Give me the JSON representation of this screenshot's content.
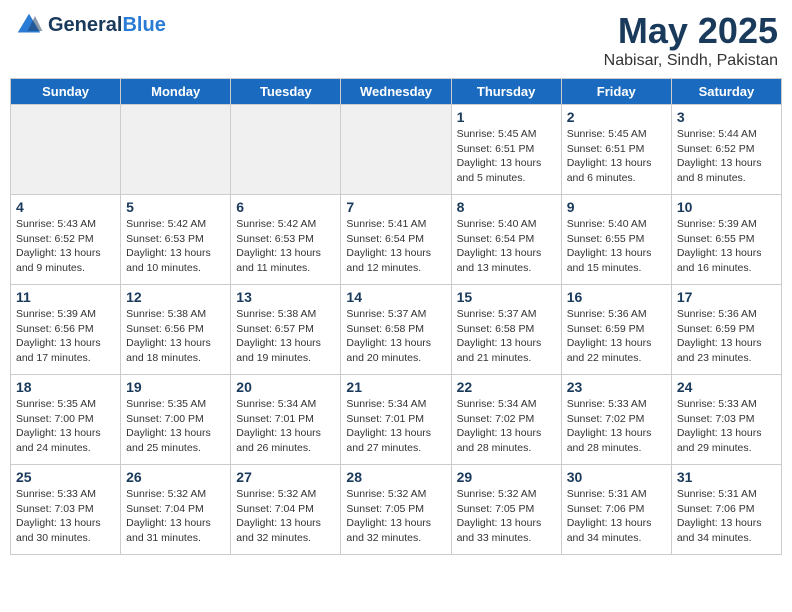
{
  "header": {
    "logo_line1": "General",
    "logo_line2": "Blue",
    "month_title": "May 2025",
    "location": "Nabisar, Sindh, Pakistan"
  },
  "weekdays": [
    "Sunday",
    "Monday",
    "Tuesday",
    "Wednesday",
    "Thursday",
    "Friday",
    "Saturday"
  ],
  "weeks": [
    [
      {
        "day": "",
        "info": "",
        "empty": true
      },
      {
        "day": "",
        "info": "",
        "empty": true
      },
      {
        "day": "",
        "info": "",
        "empty": true
      },
      {
        "day": "",
        "info": "",
        "empty": true
      },
      {
        "day": "1",
        "info": "Sunrise: 5:45 AM\nSunset: 6:51 PM\nDaylight: 13 hours\nand 5 minutes."
      },
      {
        "day": "2",
        "info": "Sunrise: 5:45 AM\nSunset: 6:51 PM\nDaylight: 13 hours\nand 6 minutes."
      },
      {
        "day": "3",
        "info": "Sunrise: 5:44 AM\nSunset: 6:52 PM\nDaylight: 13 hours\nand 8 minutes."
      }
    ],
    [
      {
        "day": "4",
        "info": "Sunrise: 5:43 AM\nSunset: 6:52 PM\nDaylight: 13 hours\nand 9 minutes."
      },
      {
        "day": "5",
        "info": "Sunrise: 5:42 AM\nSunset: 6:53 PM\nDaylight: 13 hours\nand 10 minutes."
      },
      {
        "day": "6",
        "info": "Sunrise: 5:42 AM\nSunset: 6:53 PM\nDaylight: 13 hours\nand 11 minutes."
      },
      {
        "day": "7",
        "info": "Sunrise: 5:41 AM\nSunset: 6:54 PM\nDaylight: 13 hours\nand 12 minutes."
      },
      {
        "day": "8",
        "info": "Sunrise: 5:40 AM\nSunset: 6:54 PM\nDaylight: 13 hours\nand 13 minutes."
      },
      {
        "day": "9",
        "info": "Sunrise: 5:40 AM\nSunset: 6:55 PM\nDaylight: 13 hours\nand 15 minutes."
      },
      {
        "day": "10",
        "info": "Sunrise: 5:39 AM\nSunset: 6:55 PM\nDaylight: 13 hours\nand 16 minutes."
      }
    ],
    [
      {
        "day": "11",
        "info": "Sunrise: 5:39 AM\nSunset: 6:56 PM\nDaylight: 13 hours\nand 17 minutes."
      },
      {
        "day": "12",
        "info": "Sunrise: 5:38 AM\nSunset: 6:56 PM\nDaylight: 13 hours\nand 18 minutes."
      },
      {
        "day": "13",
        "info": "Sunrise: 5:38 AM\nSunset: 6:57 PM\nDaylight: 13 hours\nand 19 minutes."
      },
      {
        "day": "14",
        "info": "Sunrise: 5:37 AM\nSunset: 6:58 PM\nDaylight: 13 hours\nand 20 minutes."
      },
      {
        "day": "15",
        "info": "Sunrise: 5:37 AM\nSunset: 6:58 PM\nDaylight: 13 hours\nand 21 minutes."
      },
      {
        "day": "16",
        "info": "Sunrise: 5:36 AM\nSunset: 6:59 PM\nDaylight: 13 hours\nand 22 minutes."
      },
      {
        "day": "17",
        "info": "Sunrise: 5:36 AM\nSunset: 6:59 PM\nDaylight: 13 hours\nand 23 minutes."
      }
    ],
    [
      {
        "day": "18",
        "info": "Sunrise: 5:35 AM\nSunset: 7:00 PM\nDaylight: 13 hours\nand 24 minutes."
      },
      {
        "day": "19",
        "info": "Sunrise: 5:35 AM\nSunset: 7:00 PM\nDaylight: 13 hours\nand 25 minutes."
      },
      {
        "day": "20",
        "info": "Sunrise: 5:34 AM\nSunset: 7:01 PM\nDaylight: 13 hours\nand 26 minutes."
      },
      {
        "day": "21",
        "info": "Sunrise: 5:34 AM\nSunset: 7:01 PM\nDaylight: 13 hours\nand 27 minutes."
      },
      {
        "day": "22",
        "info": "Sunrise: 5:34 AM\nSunset: 7:02 PM\nDaylight: 13 hours\nand 28 minutes."
      },
      {
        "day": "23",
        "info": "Sunrise: 5:33 AM\nSunset: 7:02 PM\nDaylight: 13 hours\nand 28 minutes."
      },
      {
        "day": "24",
        "info": "Sunrise: 5:33 AM\nSunset: 7:03 PM\nDaylight: 13 hours\nand 29 minutes."
      }
    ],
    [
      {
        "day": "25",
        "info": "Sunrise: 5:33 AM\nSunset: 7:03 PM\nDaylight: 13 hours\nand 30 minutes."
      },
      {
        "day": "26",
        "info": "Sunrise: 5:32 AM\nSunset: 7:04 PM\nDaylight: 13 hours\nand 31 minutes."
      },
      {
        "day": "27",
        "info": "Sunrise: 5:32 AM\nSunset: 7:04 PM\nDaylight: 13 hours\nand 32 minutes."
      },
      {
        "day": "28",
        "info": "Sunrise: 5:32 AM\nSunset: 7:05 PM\nDaylight: 13 hours\nand 32 minutes."
      },
      {
        "day": "29",
        "info": "Sunrise: 5:32 AM\nSunset: 7:05 PM\nDaylight: 13 hours\nand 33 minutes."
      },
      {
        "day": "30",
        "info": "Sunrise: 5:31 AM\nSunset: 7:06 PM\nDaylight: 13 hours\nand 34 minutes."
      },
      {
        "day": "31",
        "info": "Sunrise: 5:31 AM\nSunset: 7:06 PM\nDaylight: 13 hours\nand 34 minutes."
      }
    ]
  ]
}
